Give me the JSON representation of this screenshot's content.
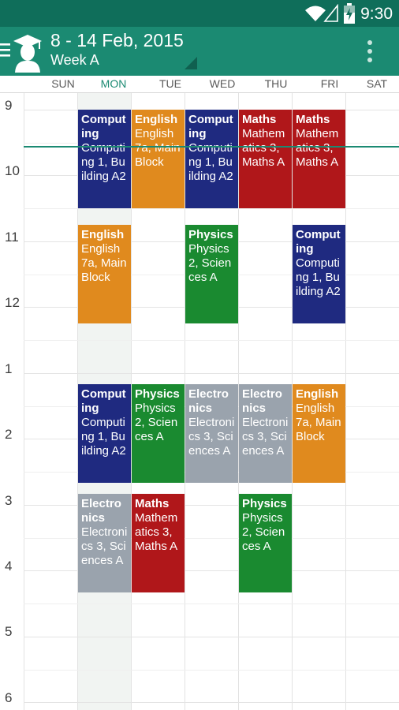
{
  "status_bar": {
    "time": "9:30"
  },
  "toolbar": {
    "title": "8 - 14 Feb, 2015",
    "subtitle": "Week A"
  },
  "days": [
    "SUN",
    "MON",
    "TUE",
    "WED",
    "THU",
    "FRI",
    "SAT"
  ],
  "hours": [
    "9",
    "10",
    "11",
    "12",
    "1",
    "2",
    "3",
    "4",
    "5",
    "6"
  ],
  "events": [
    {
      "day": "MON",
      "start": "9:00",
      "end": "10:30",
      "title": "Computing",
      "detail": "Computing 1, Building A2",
      "color": "#1f2a80"
    },
    {
      "day": "TUE",
      "start": "9:00",
      "end": "10:30",
      "title": "English",
      "detail": "English 7a, Main Block",
      "color": "#e08a1e"
    },
    {
      "day": "WED",
      "start": "9:00",
      "end": "10:30",
      "title": "Computing",
      "detail": "Computing 1, Building A2",
      "color": "#1f2a80"
    },
    {
      "day": "THU",
      "start": "9:00",
      "end": "10:30",
      "title": "Maths",
      "detail": "Mathematics 3, Maths A",
      "color": "#b0171a"
    },
    {
      "day": "FRI",
      "start": "9:00",
      "end": "10:30",
      "title": "Maths",
      "detail": "Mathematics 3, Maths A",
      "color": "#b0171a"
    },
    {
      "day": "MON",
      "start": "10:45",
      "end": "12:15",
      "title": "English",
      "detail": "English 7a, Main Block",
      "color": "#e08a1e"
    },
    {
      "day": "WED",
      "start": "10:45",
      "end": "12:15",
      "title": "Physics",
      "detail": "Physics 2, Sciences A",
      "color": "#1a8a30"
    },
    {
      "day": "FRI",
      "start": "10:45",
      "end": "12:15",
      "title": "Computing",
      "detail": "Computing 1, Building A2",
      "color": "#1f2a80"
    },
    {
      "day": "MON",
      "start": "13:10",
      "end": "14:40",
      "title": "Computing",
      "detail": "Computing 1, Building A2",
      "color": "#1f2a80"
    },
    {
      "day": "TUE",
      "start": "13:10",
      "end": "14:40",
      "title": "Physics",
      "detail": "Physics 2, Sciences A",
      "color": "#1a8a30"
    },
    {
      "day": "WED",
      "start": "13:10",
      "end": "14:40",
      "title": "Electronics",
      "detail": "Electronics 3, Sciences A",
      "color": "#9aa3ad"
    },
    {
      "day": "THU",
      "start": "13:10",
      "end": "14:40",
      "title": "Electronics",
      "detail": "Electronics 3, Sciences A",
      "color": "#9aa3ad"
    },
    {
      "day": "FRI",
      "start": "13:10",
      "end": "14:40",
      "title": "English",
      "detail": "English 7a, Main Block",
      "color": "#e08a1e"
    },
    {
      "day": "MON",
      "start": "14:50",
      "end": "16:20",
      "title": "Electronics",
      "detail": "Electronics 3, Sciences A",
      "color": "#9aa3ad"
    },
    {
      "day": "TUE",
      "start": "14:50",
      "end": "16:20",
      "title": "Maths",
      "detail": "Mathematics 3, Maths A",
      "color": "#b0171a"
    },
    {
      "day": "THU",
      "start": "14:50",
      "end": "16:20",
      "title": "Physics",
      "detail": "Physics 2, Sciences A",
      "color": "#1a8a30"
    }
  ],
  "colors": {
    "status_bar": "#0f6e5a",
    "toolbar": "#1b8a72",
    "now_line": "#1b8a72"
  }
}
